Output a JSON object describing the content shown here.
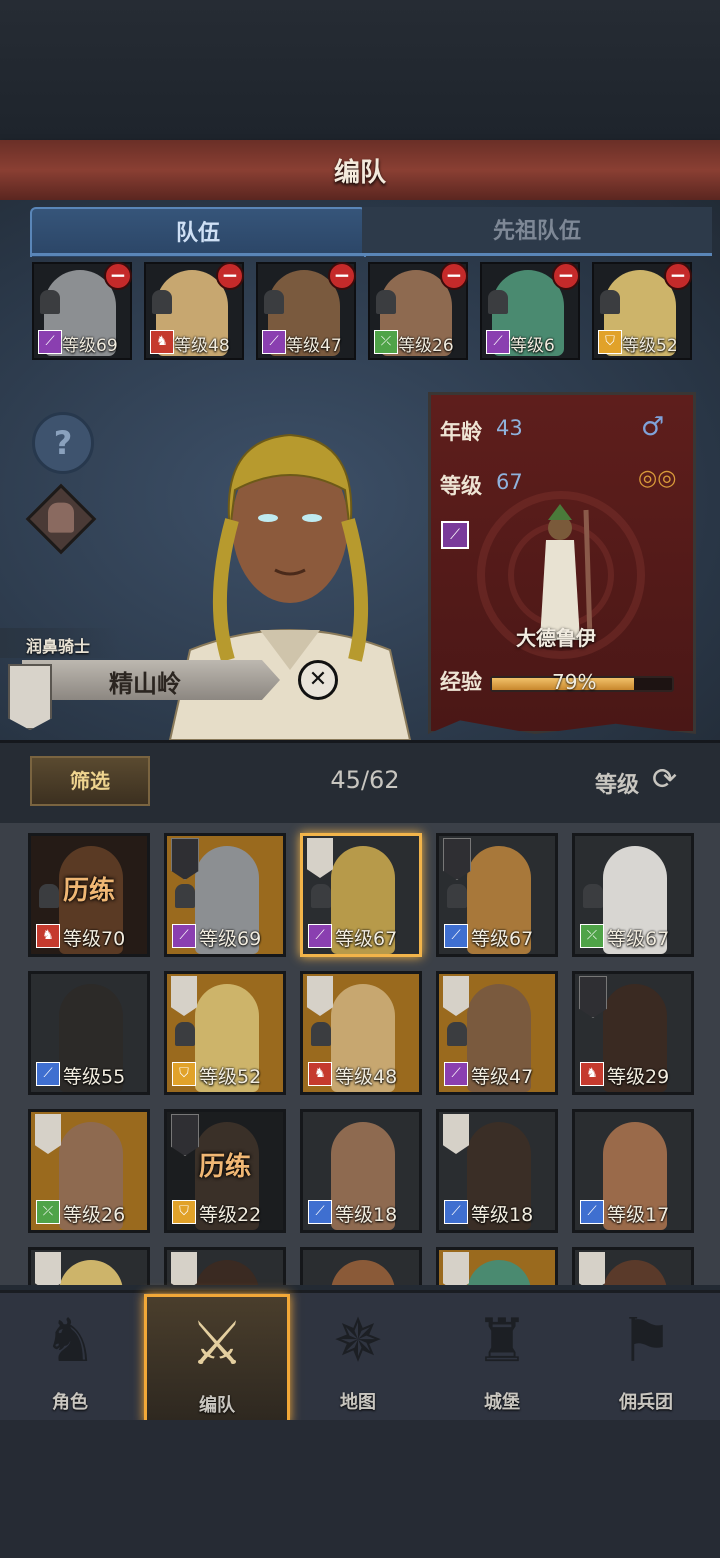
{
  "header": {
    "title": "编队"
  },
  "tabs": [
    {
      "label": "队伍"
    },
    {
      "label": "先祖队伍"
    }
  ],
  "team_slots": [
    {
      "level": "等级69",
      "class_icon": "staff-icon",
      "class_color": "#8a3fb0",
      "portrait_color": "#8c8f92"
    },
    {
      "level": "等级48",
      "class_icon": "beast-icon",
      "class_color": "#c53a2e",
      "portrait_color": "#c7a770"
    },
    {
      "level": "等级47",
      "class_icon": "staff-icon",
      "class_color": "#8a3fb0",
      "portrait_color": "#7a5a3e"
    },
    {
      "level": "等级26",
      "class_icon": "bow-icon",
      "class_color": "#4fa348",
      "portrait_color": "#8e6a50"
    },
    {
      "level": "等级6",
      "class_icon": "staff-icon",
      "class_color": "#8a3fb0",
      "portrait_color": "#4a8a70"
    },
    {
      "level": "等级52",
      "class_icon": "shield-icon",
      "class_color": "#e1a22a",
      "portrait_color": "#cdb46a"
    }
  ],
  "character": {
    "title": "润鼻骑士",
    "name": "精山岭",
    "age_label": "年龄",
    "age": "43",
    "level_label": "等级",
    "level": "67",
    "class_name": "大德鲁伊",
    "exp_label": "经验",
    "exp_percent": "79%",
    "exp_fraction": 0.79
  },
  "filter": {
    "label": "筛选",
    "count": "45/62",
    "sort_label": "等级"
  },
  "roster": [
    {
      "level": "等级70",
      "class_icon": "beast-icon",
      "class_color": "#c53a2e",
      "bg": "#3a2a22",
      "face": "#8a5a38",
      "badge": "",
      "merc": true,
      "training": "历练",
      "selected": false
    },
    {
      "level": "等级69",
      "class_icon": "staff-icon",
      "class_color": "#8a3fb0",
      "bg": "#9a6a1e",
      "face": "#8c8f92",
      "badge": "dark",
      "merc": true,
      "training": "",
      "selected": false
    },
    {
      "level": "等级67",
      "class_icon": "staff-icon",
      "class_color": "#8a3fb0",
      "bg": "#2a2d30",
      "face": "#b79a4a",
      "badge": "light",
      "merc": true,
      "training": "",
      "selected": true
    },
    {
      "level": "等级67",
      "class_icon": "sword-icon",
      "class_color": "#3f6fd0",
      "bg": "#2a2d30",
      "face": "#a8783a",
      "badge": "dark",
      "merc": true,
      "training": "",
      "selected": false
    },
    {
      "level": "等级67",
      "class_icon": "bow-icon",
      "class_color": "#4fa348",
      "bg": "#2a2d30",
      "face": "#d8d6d2",
      "badge": "",
      "merc": true,
      "training": "",
      "selected": false
    },
    {
      "level": "等级55",
      "class_icon": "sword-icon",
      "class_color": "#3f6fd0",
      "bg": "#2a2d30",
      "face": "#2c2a28",
      "badge": "",
      "merc": false,
      "training": "",
      "selected": false
    },
    {
      "level": "等级52",
      "class_icon": "shield-icon",
      "class_color": "#e1a22a",
      "bg": "#9a6a1e",
      "face": "#cdb46a",
      "badge": "light",
      "merc": true,
      "training": "",
      "selected": false
    },
    {
      "level": "等级48",
      "class_icon": "beast-icon",
      "class_color": "#c53a2e",
      "bg": "#9a6a1e",
      "face": "#c7a770",
      "badge": "light",
      "merc": true,
      "training": "",
      "selected": false
    },
    {
      "level": "等级47",
      "class_icon": "staff-icon",
      "class_color": "#8a3fb0",
      "bg": "#9a6a1e",
      "face": "#7a5a3e",
      "badge": "light",
      "merc": true,
      "training": "",
      "selected": false
    },
    {
      "level": "等级29",
      "class_icon": "beast-icon",
      "class_color": "#c53a2e",
      "bg": "#2a2d30",
      "face": "#3a2a22",
      "badge": "dark",
      "merc": false,
      "training": "",
      "selected": false
    },
    {
      "level": "等级26",
      "class_icon": "bow-icon",
      "class_color": "#4fa348",
      "bg": "#9a6a1e",
      "face": "#8e6a50",
      "badge": "light",
      "merc": false,
      "training": "",
      "selected": false
    },
    {
      "level": "等级22",
      "class_icon": "shield-icon",
      "class_color": "#e1a22a",
      "bg": "#2a2d30",
      "face": "#5a4a3e",
      "badge": "dark",
      "merc": false,
      "training": "历练",
      "selected": false
    },
    {
      "level": "等级18",
      "class_icon": "sword-icon",
      "class_color": "#3f6fd0",
      "bg": "#2a2d30",
      "face": "#8e6a50",
      "badge": "",
      "merc": false,
      "training": "",
      "selected": false
    },
    {
      "level": "等级18",
      "class_icon": "sword-icon",
      "class_color": "#3f6fd0",
      "bg": "#2a2d30",
      "face": "#3a2e26",
      "badge": "light",
      "merc": false,
      "training": "",
      "selected": false
    },
    {
      "level": "等级17",
      "class_icon": "sword-icon",
      "class_color": "#3f6fd0",
      "bg": "#2a2d30",
      "face": "#9a6a4a",
      "badge": "",
      "merc": false,
      "training": "",
      "selected": false
    },
    {
      "level": "",
      "class_icon": "",
      "class_color": "",
      "bg": "#2a2d30",
      "face": "#cdb46a",
      "badge": "light",
      "merc": false,
      "training": "",
      "selected": false
    },
    {
      "level": "",
      "class_icon": "",
      "class_color": "",
      "bg": "#2a2d30",
      "face": "#3a2a22",
      "badge": "light",
      "merc": false,
      "training": "",
      "selected": false
    },
    {
      "level": "",
      "class_icon": "",
      "class_color": "",
      "bg": "#2a2d30",
      "face": "#8a5a38",
      "badge": "",
      "merc": false,
      "training": "",
      "selected": false
    },
    {
      "level": "",
      "class_icon": "",
      "class_color": "",
      "bg": "#9a6a1e",
      "face": "#4a8a70",
      "badge": "light",
      "merc": false,
      "training": "",
      "selected": false
    },
    {
      "level": "",
      "class_icon": "",
      "class_color": "",
      "bg": "#2a2d30",
      "face": "#5a3a2a",
      "badge": "light",
      "merc": false,
      "training": "",
      "selected": false
    }
  ],
  "nav": [
    {
      "label": "角色",
      "icon": "knight-icon",
      "active": false
    },
    {
      "label": "编队",
      "icon": "party-icon",
      "active": true
    },
    {
      "label": "地图",
      "icon": "map-compass-icon",
      "active": false
    },
    {
      "label": "城堡",
      "icon": "castle-icon",
      "active": false
    },
    {
      "label": "佣兵团",
      "icon": "mercenary-icon",
      "active": false
    }
  ]
}
